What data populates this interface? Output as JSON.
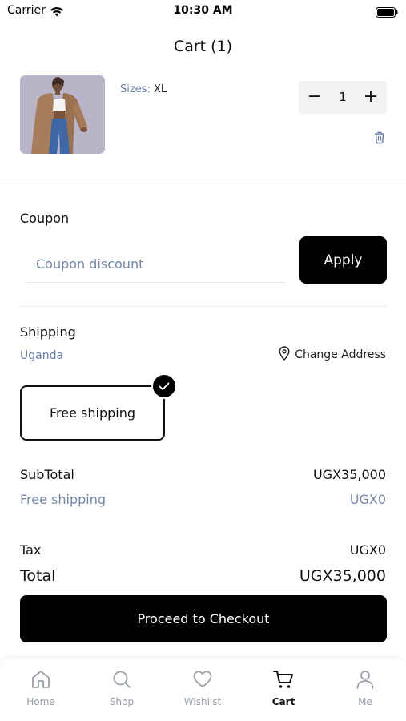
{
  "status_bar": {
    "carrier": "Carrier",
    "time": "10:30 AM"
  },
  "header": {
    "title": "Cart (1)"
  },
  "cart_item": {
    "size_label": "Sizes:",
    "size_value": "XL",
    "quantity": "1",
    "minus_label": "−",
    "plus_label": "+"
  },
  "coupon": {
    "title": "Coupon",
    "placeholder": "Coupon discount",
    "apply_label": "Apply"
  },
  "shipping": {
    "title": "Shipping",
    "country": "Uganda",
    "change_address_label": "Change Address",
    "option_label": "Free shipping"
  },
  "summary": {
    "subtotal_label": "SubTotal",
    "subtotal_value": "UGX35,000",
    "shipping_label": "Free shipping",
    "shipping_value": "UGX0",
    "tax_label": "Tax",
    "tax_value": "UGX0",
    "total_label": "Total",
    "total_value": "UGX35,000"
  },
  "checkout_label": "Proceed to Checkout",
  "tabs": [
    {
      "label": "Home",
      "icon": "home-icon"
    },
    {
      "label": "Shop",
      "icon": "search-icon"
    },
    {
      "label": "Wishlist",
      "icon": "heart-icon"
    },
    {
      "label": "Cart",
      "icon": "cart-icon",
      "active": true
    },
    {
      "label": "Me",
      "icon": "user-icon"
    }
  ],
  "colors": {
    "accent": "#000000",
    "muted_text": "#7487a6",
    "inactive_tab": "#9aa0a8"
  }
}
